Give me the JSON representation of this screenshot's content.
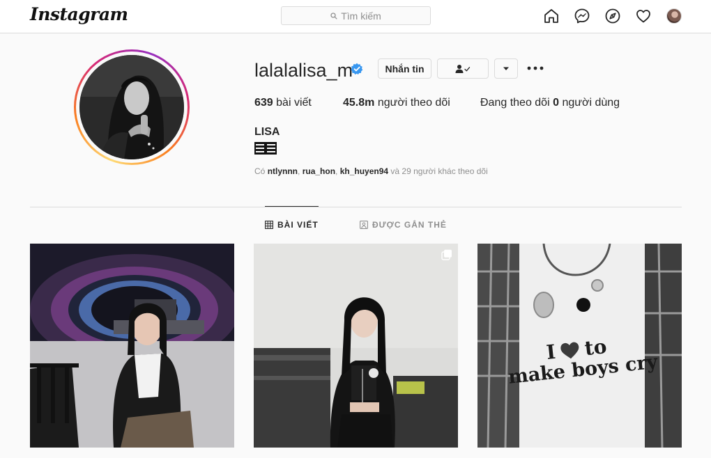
{
  "nav": {
    "logo": "Instagram",
    "search_placeholder": "Tìm kiếm",
    "icons": [
      "home-icon",
      "messenger-icon",
      "explore-icon",
      "heart-icon",
      "profile-avatar"
    ]
  },
  "profile": {
    "username": "lalalalisa_m",
    "verified": true,
    "message_button": "Nhắn tin",
    "stats": {
      "posts_count": "639",
      "posts_label": "bài viết",
      "followers_count": "45.8m",
      "followers_label": "người theo dõi",
      "following_prefix": "Đang theo dõi",
      "following_count": "0",
      "following_label": "người dùng"
    },
    "full_name": "LISA",
    "followed_by": {
      "prefix": "Có",
      "users": [
        "ntlynnn",
        "rua_hon",
        "kh_huyen94"
      ],
      "suffix": "và 29 người khác theo dõi"
    }
  },
  "tabs": {
    "posts": "BÀI VIẾT",
    "tagged": "ĐƯỢC GẮN THẺ"
  },
  "posts": [
    {
      "description": "photo",
      "multi": false
    },
    {
      "description": "photo",
      "multi": true
    },
    {
      "description": "photo",
      "multi": false
    },
    {
      "shirt_text_line1": "I",
      "shirt_text_word": "to",
      "shirt_text_line2": "make boys cry"
    }
  ],
  "colors": {
    "verified_blue": "#3897f0",
    "border": "#dbdbdb",
    "muted_text": "#8e8e8e"
  }
}
